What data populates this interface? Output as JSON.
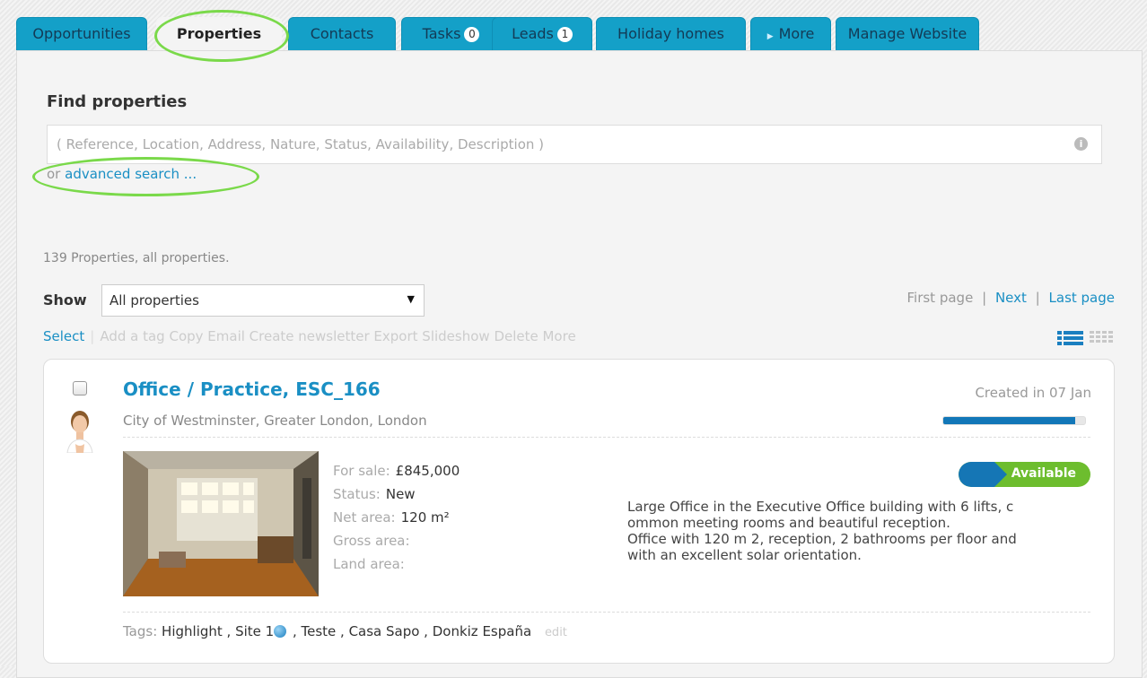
{
  "tabs": [
    {
      "label": "Opportunities",
      "active": false
    },
    {
      "label": "Properties",
      "active": true
    },
    {
      "label": "Contacts",
      "active": false
    },
    {
      "label": "Tasks",
      "badge": "0",
      "active": false
    },
    {
      "label": "Leads",
      "badge": "1",
      "active": false
    },
    {
      "label": "Holiday homes",
      "active": false
    },
    {
      "label": "More",
      "active": false
    },
    {
      "label": "Manage Website",
      "active": false
    }
  ],
  "search": {
    "title": "Find properties",
    "placeholder": "( Reference, Location, Address, Nature, Status, Availability, Description )",
    "or_text": "or",
    "advanced_link": "advanced search ..."
  },
  "results": {
    "count_text": "139 Properties, all properties.",
    "show_label": "Show",
    "show_selected": "All properties",
    "pager": {
      "first": "First page",
      "next": "Next",
      "last": "Last page"
    },
    "actions": {
      "select": "Select",
      "items": "Add a tag Copy Email Create newsletter Export Slideshow Delete More"
    }
  },
  "property": {
    "title": "Office / Practice, ESC_166",
    "location": "City of Westminster, Greater London, London",
    "created": "Created in 07 Jan",
    "completeness": 0.93,
    "status_badge": "Available",
    "specs": [
      {
        "label": "For sale:",
        "value": "£845,000"
      },
      {
        "label": "Status:",
        "value": "New"
      },
      {
        "label": "Net area:",
        "value": "120 m²"
      },
      {
        "label": "Gross area:",
        "value": ""
      },
      {
        "label": "Land area:",
        "value": ""
      }
    ],
    "description_1": "Large Office in the Executive Office building with 6 lifts, c",
    "description_2": "ommon meeting rooms and beautiful reception.",
    "description_3": "Office with 120 m 2, reception, 2 bathrooms per floor and",
    "description_4": "with an excellent solar orientation.",
    "tags_label": "Tags:",
    "tags_before_icon": "Highlight , Site 1",
    "tags_after_icon": " , Teste , Casa Sapo , Donkiz España",
    "tags_edit": "edit"
  },
  "colors": {
    "tab": "#14a0c8",
    "link": "#1a8fc4",
    "highlight_circle": "#7ad94a",
    "available": "#6dbd2e"
  }
}
